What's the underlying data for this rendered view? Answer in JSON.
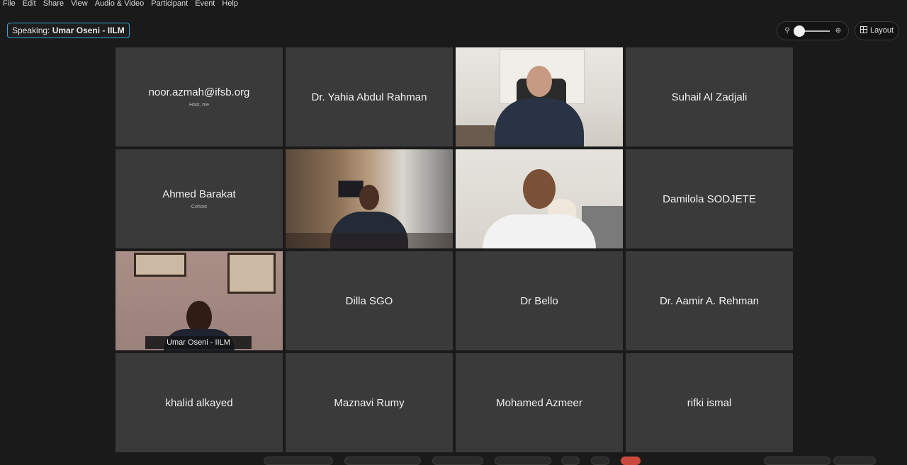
{
  "menu": [
    "File",
    "Edit",
    "Share",
    "View",
    "Audio & Video",
    "Participant",
    "Event",
    "Help"
  ],
  "speaking": {
    "label": "Speaking:",
    "name": "Umar Oseni - IILM"
  },
  "zoom": {
    "level": 0.1
  },
  "layout_label": "Layout",
  "tiles": [
    {
      "name": "noor.azmah@ifsb.org",
      "role": "Host, me"
    },
    {
      "name": "Dr. Yahia Abdul Rahman",
      "role": ""
    },
    {
      "name": "",
      "role": ""
    },
    {
      "name": "Suhail Al Zadjali",
      "role": ""
    },
    {
      "name": "Ahmed Barakat",
      "role": "Cohost"
    },
    {
      "name": "",
      "role": ""
    },
    {
      "name": "",
      "role": ""
    },
    {
      "name": "Damilola SODJETE",
      "role": ""
    },
    {
      "name": "Umar Oseni - IILM",
      "role": ""
    },
    {
      "name": "Dilla SGO",
      "role": ""
    },
    {
      "name": "Dr Bello",
      "role": ""
    },
    {
      "name": "Dr. Aamir A. Rehman",
      "role": ""
    },
    {
      "name": "khalid alkayed",
      "role": ""
    },
    {
      "name": "Maznavi Rumy",
      "role": ""
    },
    {
      "name": "Mohamed Azmeer",
      "role": ""
    },
    {
      "name": "rifki ismal",
      "role": ""
    }
  ]
}
